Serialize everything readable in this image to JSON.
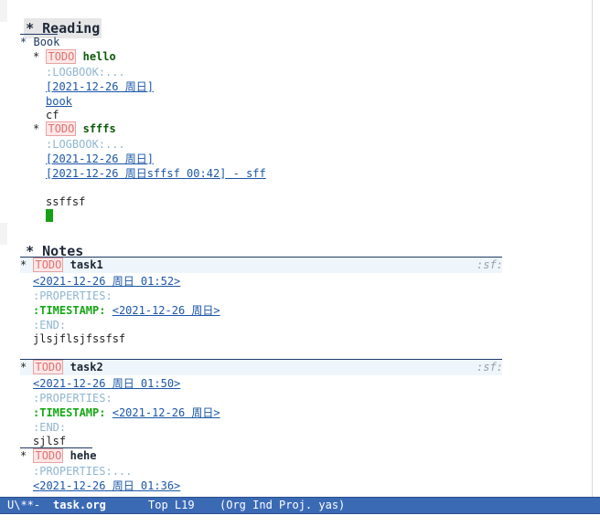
{
  "reading": {
    "star": "*",
    "title": "Reading",
    "book": {
      "star": "*",
      "title": "Book"
    },
    "entry1": {
      "star": "*",
      "todo": "TODO",
      "title": "hello",
      "logbook": ":LOGBOOK:...",
      "date": "[2021-12-26 周日]",
      "link": "book",
      "text": "cf"
    },
    "entry2": {
      "star": "*",
      "todo": "TODO",
      "title": "sfffs",
      "logbook": ":LOGBOOK:...",
      "date": "[2021-12-26 周日]",
      "date_range": "[2021-12-26 周日sffsf 00:42] - sff",
      "text": "ssffsf"
    }
  },
  "notes": {
    "star": "*",
    "title": "Notes",
    "task1": {
      "star": "*",
      "todo": "TODO",
      "title": "task1",
      "tag": ":sf:",
      "date": "<2021-12-26 周日 01:52>",
      "properties": ":PROPERTIES:",
      "timestamp_key": ":TIMESTAMP:",
      "timestamp_val": "<2021-12-26 周日>",
      "end": ":END:",
      "text": "jlsjflsjfssfsf"
    },
    "task2": {
      "star": "*",
      "todo": "TODO",
      "title": "task2",
      "tag": ":sf:",
      "date": "<2021-12-26 周日 01:50>",
      "properties": ":PROPERTIES:",
      "timestamp_key": ":TIMESTAMP:",
      "timestamp_val": "<2021-12-26 周日>",
      "end": ":END:",
      "text": "sjlsf"
    },
    "hehe": {
      "star": "*",
      "todo": "TODO",
      "title": "hehe",
      "properties": ":PROPERTIES:...",
      "date": "<2021-12-26 周日 01:36>"
    }
  },
  "modeline": {
    "status": "U\\**-",
    "file": "task.org",
    "position": "Top L19",
    "modes": "(Org Ind Proj. yas)"
  }
}
